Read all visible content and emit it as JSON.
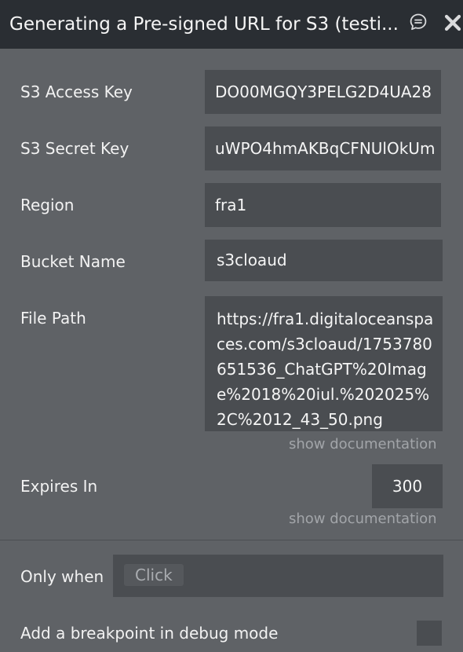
{
  "header": {
    "title": "Generating a Pre-signed URL for S3 (testi...",
    "comment_icon": "comment-icon",
    "close_icon": "close-icon"
  },
  "fields": {
    "access_key": {
      "label": "S3 Access Key",
      "value": "DO00MGQY3PELG2D4UA28"
    },
    "secret_key": {
      "label": "S3 Secret Key",
      "value": "uWPO4hmAKBqCFNUlOkUm"
    },
    "region": {
      "label": "Region",
      "value": "fra1"
    },
    "bucket": {
      "label": "Bucket Name",
      "value": "s3cloaud"
    },
    "file_path": {
      "label": "File Path",
      "value": "https://fra1.digitaloceanspaces.com/s3cloaud/1753780651536_ChatGPT%20Image%2018%20iul.%202025%2C%2012_43_50.png",
      "doc_link": "show documentation"
    },
    "expires": {
      "label": "Expires In",
      "value": "300",
      "doc_link": "show documentation"
    }
  },
  "only_when": {
    "label": "Only when",
    "chip": "Click"
  },
  "breakpoint": {
    "label": "Add a breakpoint in debug mode",
    "checked": false
  },
  "colors": {
    "titlebar_bg": "#2a2e33",
    "panel_bg": "#5f6266",
    "field_bg": "#4a4d51",
    "muted_text": "#a2a5a9"
  }
}
